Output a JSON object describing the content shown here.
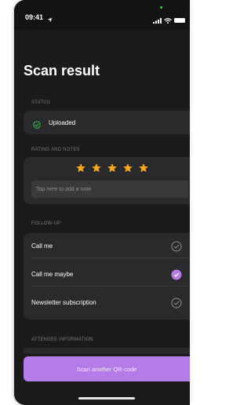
{
  "status_bar": {
    "time": "09:41"
  },
  "page": {
    "title": "Scan result"
  },
  "status_section": {
    "label": "STATUS",
    "value": "Uploaded"
  },
  "rating_section": {
    "label": "RATING AND NOTES",
    "stars": 5,
    "rating_value": 5,
    "note_placeholder": "Tap here to add a note"
  },
  "followup_section": {
    "label": "FOLLOW-UP",
    "items": [
      {
        "label": "Call me",
        "checked": false
      },
      {
        "label": "Call me maybe",
        "checked": true
      },
      {
        "label": "Newsletter subscription",
        "checked": false
      }
    ]
  },
  "attendee_section": {
    "label": "ATTENDEE INFORMATION"
  },
  "primary_action": {
    "label": "Scan another QR-code"
  },
  "colors": {
    "background": "#1b1b1c",
    "card": "#2a2a2c",
    "accent": "#b57ce8",
    "star": "#f5a623",
    "status_ok": "#34c759"
  }
}
